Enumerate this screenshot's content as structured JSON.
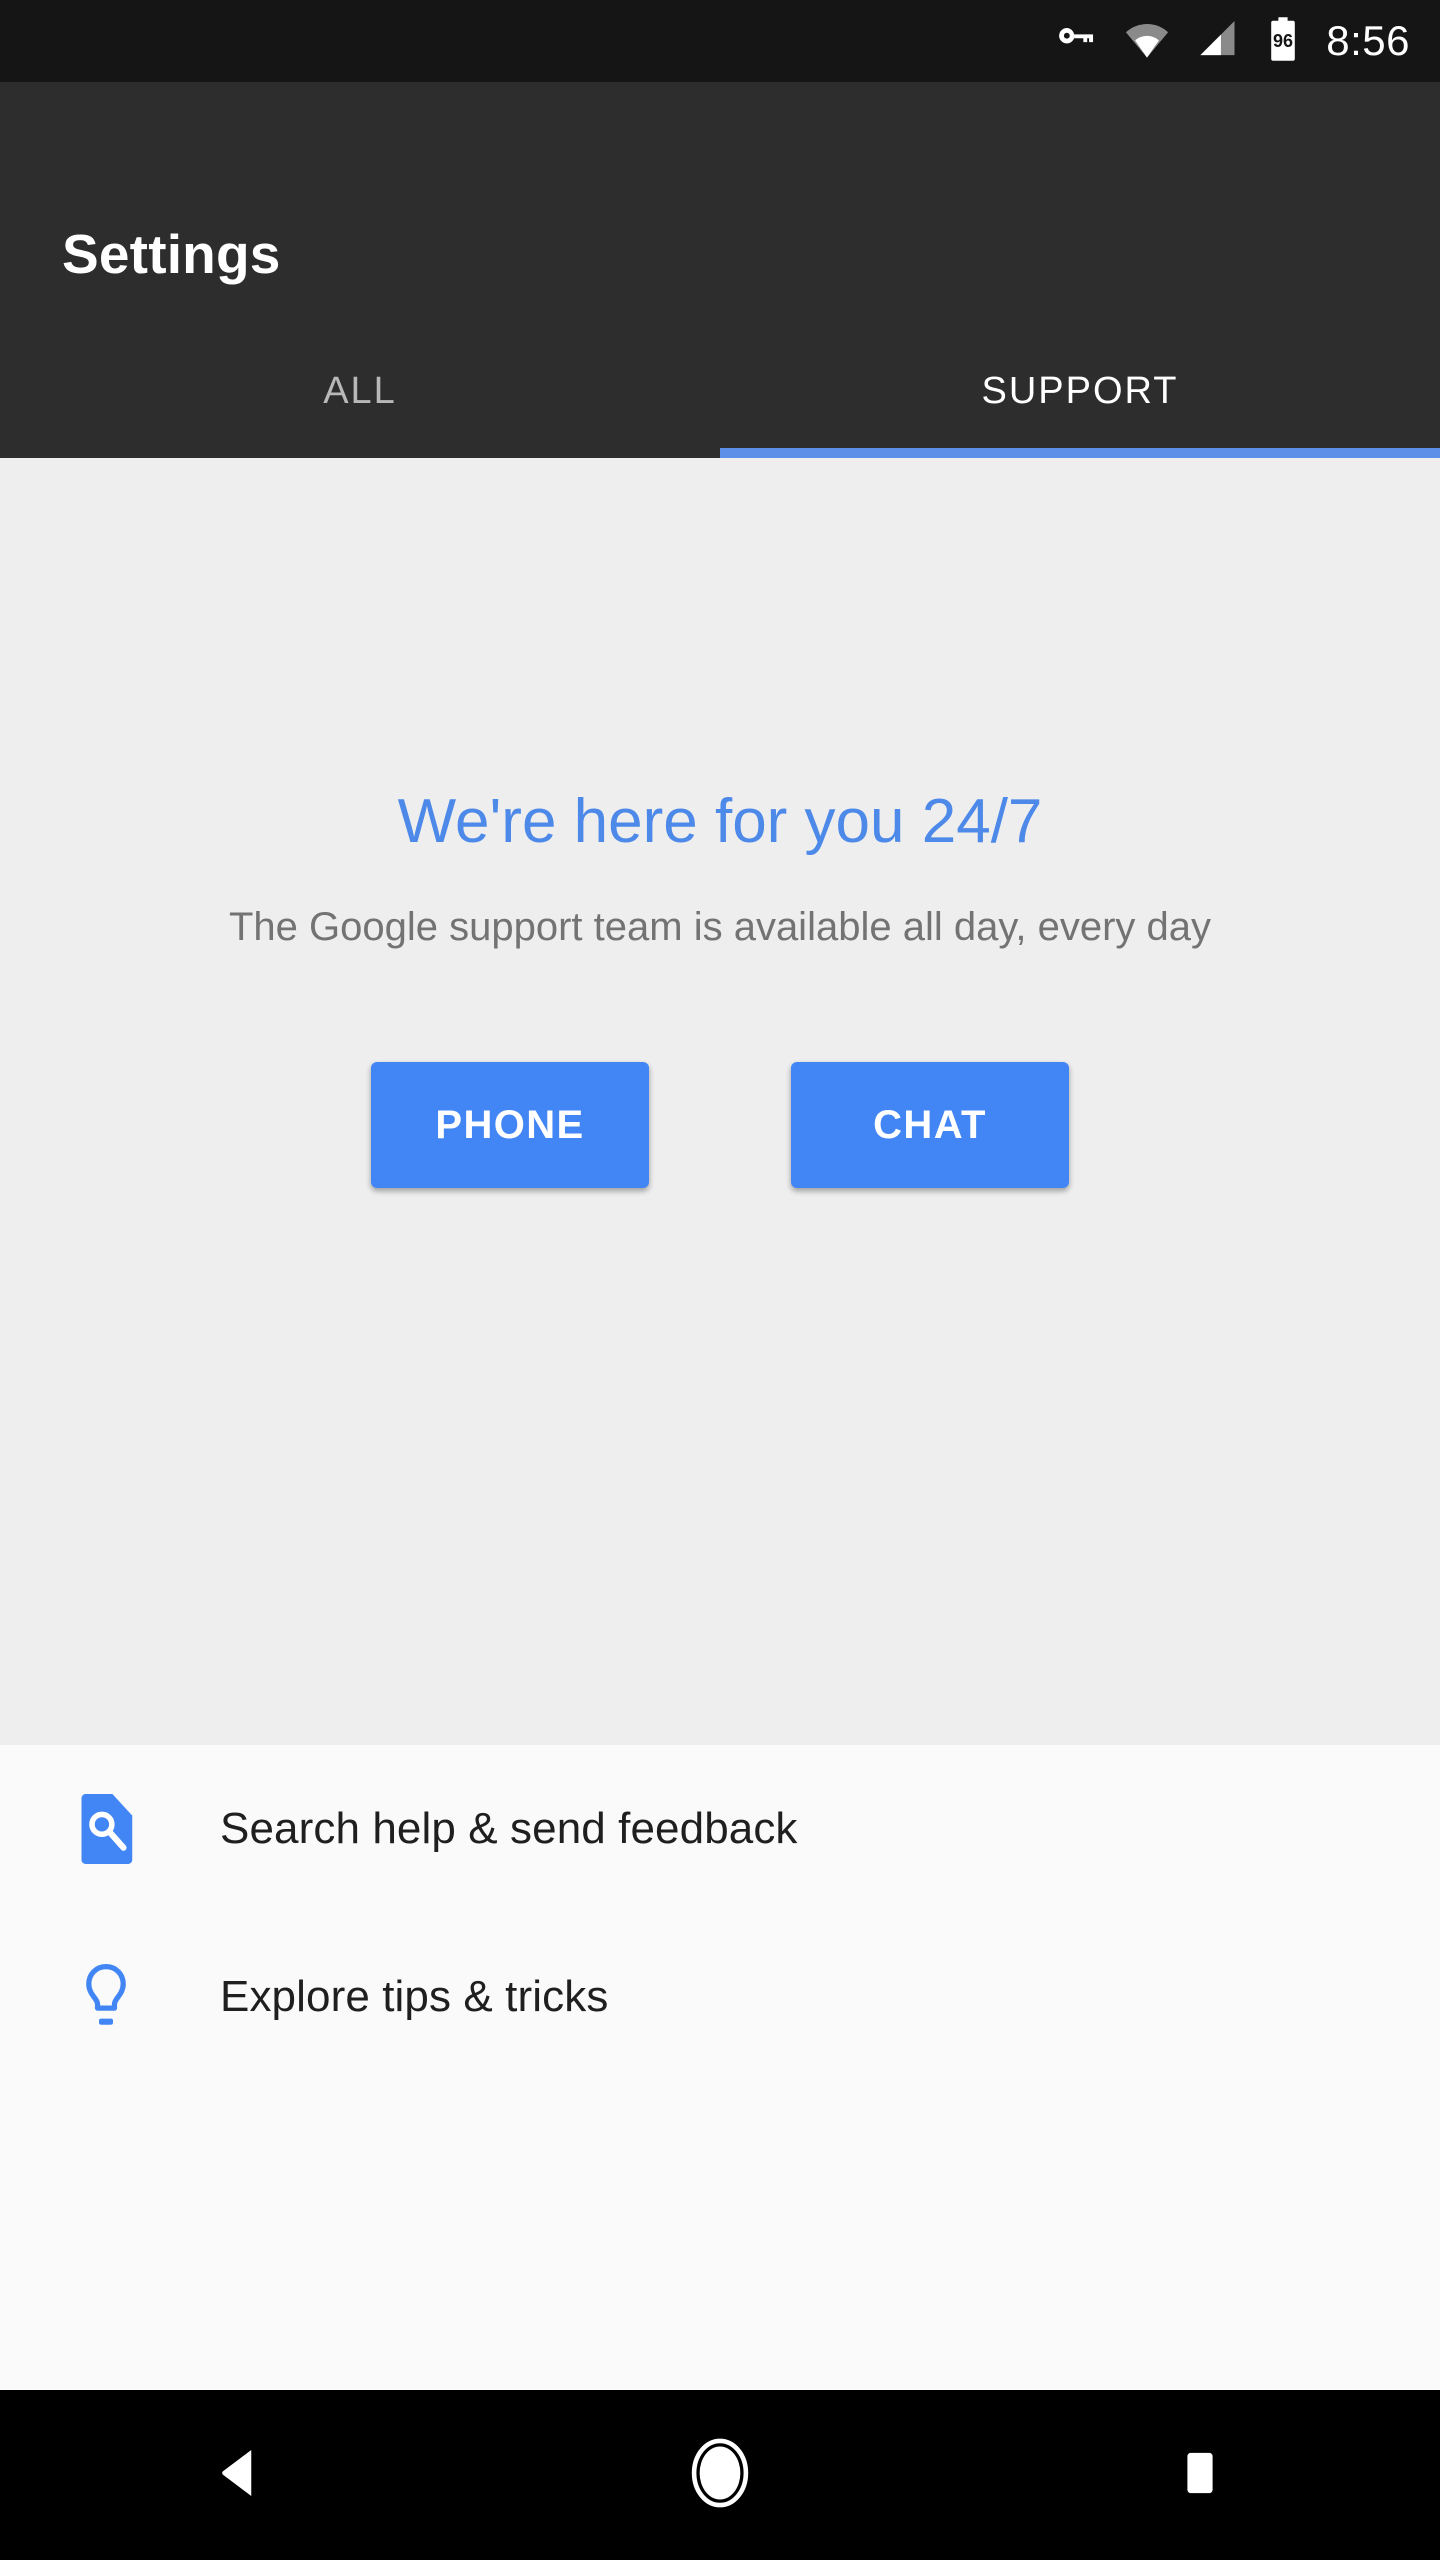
{
  "statusbar": {
    "time": "8:56",
    "battery_level": "96",
    "icons": [
      "vpn-key-icon",
      "wifi-icon",
      "cellular-signal-icon",
      "battery-icon"
    ]
  },
  "appbar": {
    "title": "Settings"
  },
  "tabs": [
    {
      "label": "ALL",
      "active": false
    },
    {
      "label": "SUPPORT",
      "active": true
    }
  ],
  "hero": {
    "title": "We're here for you 24/7",
    "subtitle": "The Google support team is available all day, every day",
    "buttons": [
      {
        "label": "PHONE"
      },
      {
        "label": "CHAT"
      }
    ]
  },
  "list": [
    {
      "label": "Search help & send feedback",
      "icon": "help-search-icon"
    },
    {
      "label": "Explore tips & tricks",
      "icon": "lightbulb-icon"
    }
  ],
  "navbar": {
    "back": "back-icon",
    "home": "home-icon",
    "recents": "recents-icon"
  },
  "colors": {
    "status_bar_bg": "#151515",
    "app_bar_bg": "#2d2d2d",
    "accent_blue": "#4285f4",
    "indicator_blue": "#5b8fe8",
    "hero_bg": "#eeeeee",
    "hero_title": "#4d89e8",
    "hero_subtitle": "#737373",
    "list_bg": "#fafafa",
    "nav_bar_bg": "#000000"
  }
}
